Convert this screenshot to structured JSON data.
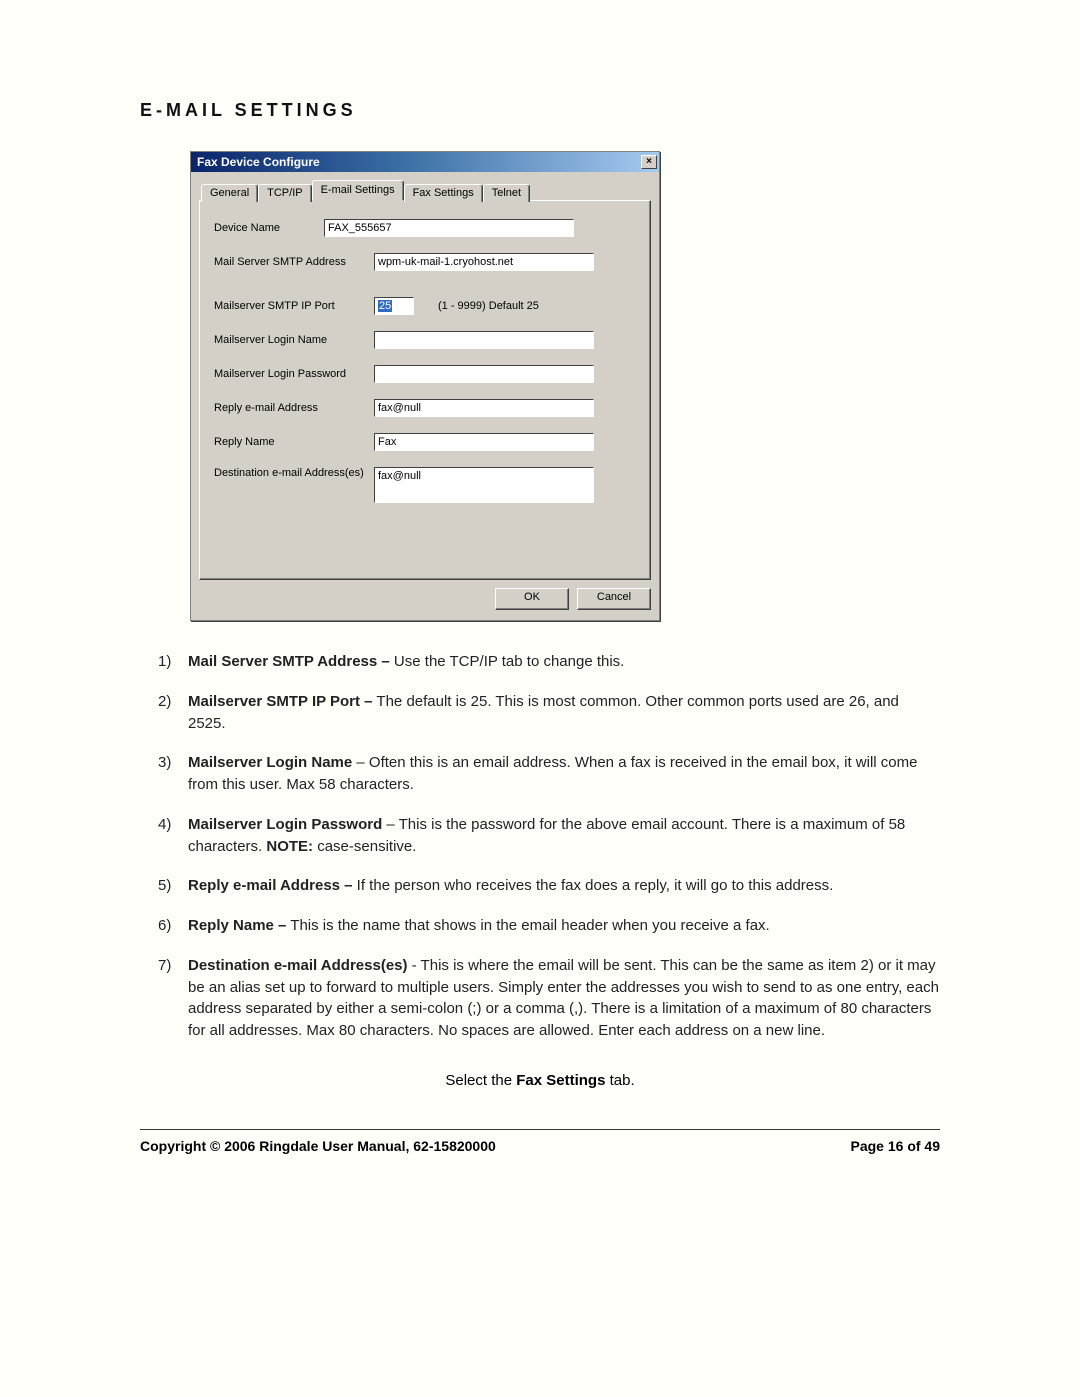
{
  "heading": "E-MAIL SETTINGS",
  "dialog": {
    "title": "Fax Device Configure",
    "close_glyph": "×",
    "tabs": {
      "general": "General",
      "tcpip": "TCP/IP",
      "email": "E-mail Settings",
      "fax": "Fax Settings",
      "telnet": "Telnet"
    },
    "labels": {
      "device_name": "Device Name",
      "smtp_addr": "Mail Server SMTP Address",
      "smtp_port": "Mailserver SMTP IP Port",
      "login_name": "Mailserver Login Name",
      "login_pass": "Mailserver Login Password",
      "reply_addr": "Reply e-mail Address",
      "reply_name": "Reply Name",
      "dest_addr": "Destination e-mail Address(es)"
    },
    "values": {
      "device_name": "FAX_555657",
      "smtp_addr": "wpm-uk-mail-1.cryohost.net",
      "smtp_port": "25",
      "port_hint": "(1 - 9999)  Default 25",
      "login_name": "",
      "login_pass": "",
      "reply_addr": "fax@null",
      "reply_name": "Fax",
      "dest_addr": "fax@null"
    },
    "buttons": {
      "ok": "OK",
      "cancel": "Cancel"
    }
  },
  "descriptions": [
    {
      "n": "1)",
      "lead": "Mail Server SMTP Address –",
      "body": " Use the TCP/IP tab to change this."
    },
    {
      "n": "2)",
      "lead": "Mailserver SMTP IP Port –",
      "body": " The default is 25. This is most common. Other common ports used are 26, and 2525."
    },
    {
      "n": "3)",
      "lead": "Mailserver Login Name",
      "body": " – Often this is an email address. When a fax is received in the email box, it will come from this user.  Max 58 characters."
    },
    {
      "n": "4)",
      "lead": "Mailserver Login Password",
      "body": " – This is the password for the above email account.  There is a maximum of 58 characters. ",
      "lead2": "NOTE:",
      "body2": " case-sensitive."
    },
    {
      "n": "5)",
      "lead": "Reply e-mail Address –",
      "body": " If the person who receives the fax does a reply, it will go to this address."
    },
    {
      "n": "6)",
      "lead": "Reply Name –",
      "body": " This is the name that shows in the email header when you receive a fax."
    },
    {
      "n": "7)",
      "lead": "Destination e-mail Address(es)",
      "body": " - This is where the email will be sent. This can be the same as item 2) or it may be an alias set up to forward to multiple users.  Simply enter the addresses you wish to send to as one entry, each address separated by either a semi-colon (;) or a comma (,). There is a limitation of a maximum of 80 characters for all addresses. Max 80 characters. No spaces are allowed. Enter each address on a new line."
    }
  ],
  "select_line_pre": "Select the ",
  "select_line_bold": "Fax Settings",
  "select_line_post": " tab.",
  "footer": {
    "left": "Copyright © 2006 Ringdale   User Manual, 62-15820000",
    "right": "Page 16 of 49"
  }
}
